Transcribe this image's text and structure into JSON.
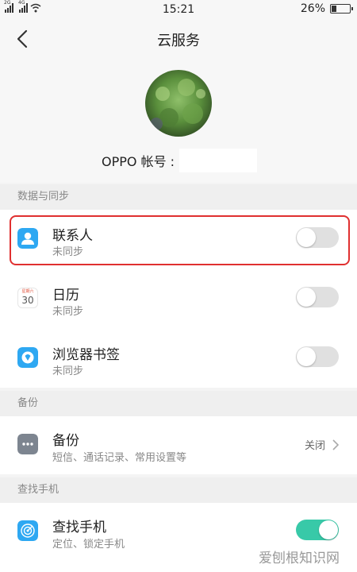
{
  "status_bar": {
    "signal1": "2G",
    "signal2": "4G",
    "time": "15:21",
    "battery": "26%",
    "battery_level": 0.26
  },
  "nav": {
    "title": "云服务"
  },
  "profile": {
    "account_label": "OPPO 帐号 :"
  },
  "sections": {
    "sync": {
      "header": "数据与同步",
      "items": [
        {
          "title": "联系人",
          "subtitle": "未同步",
          "enabled": false
        },
        {
          "title": "日历",
          "subtitle": "未同步",
          "enabled": false,
          "icon_weekday": "星期六",
          "icon_date": "30"
        },
        {
          "title": "浏览器书签",
          "subtitle": "未同步",
          "enabled": false
        }
      ]
    },
    "backup": {
      "header": "备份",
      "item": {
        "title": "备份",
        "subtitle": "短信、通话记录、常用设置等",
        "status": "关闭"
      }
    },
    "find": {
      "header": "查找手机",
      "item": {
        "title": "查找手机",
        "subtitle": "定位、锁定手机",
        "enabled": true
      }
    }
  },
  "watermark": "爱刨根知识网",
  "colors": {
    "accent": "#38c9a8",
    "icon_blue": "#2ea8f2",
    "highlight": "#e03030"
  }
}
